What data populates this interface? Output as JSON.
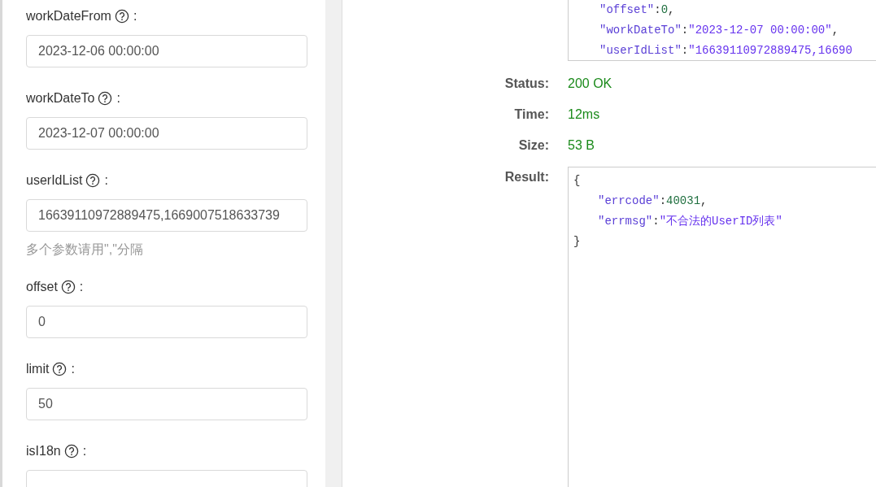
{
  "params": [
    {
      "label": "workDateFrom",
      "colon": ":",
      "value": "2023-12-06 00:00:00"
    },
    {
      "label": "workDateTo",
      "colon": ":",
      "value": "2023-12-07 00:00:00"
    },
    {
      "label": "userIdList",
      "colon": ":",
      "value": "16639110972889475,1669007518633739",
      "hint": "多个参数请用\",\"分隔"
    },
    {
      "label": "offset",
      "colon": ":",
      "value": "0"
    },
    {
      "label": "limit",
      "colon": ":",
      "value": "50"
    },
    {
      "label": "isI18n",
      "colon": ":"
    }
  ],
  "request_body": [
    {
      "kind": "number",
      "key": "\"offset\"",
      "colon": ":",
      "value": "0",
      "comma": ","
    },
    {
      "kind": "string",
      "key": "\"workDateTo\"",
      "colon": ":",
      "value": "\"2023-12-07 00:00:00\"",
      "comma": ","
    },
    {
      "kind": "string",
      "key": "\"userIdList\"",
      "colon": ":",
      "value": "\"16639110972889475,16690"
    }
  ],
  "response_meta": [
    {
      "label": "Status:",
      "value": "200 OK"
    },
    {
      "label": "Time:",
      "value": "12ms"
    },
    {
      "label": "Size:",
      "value": "53 B"
    }
  ],
  "result": {
    "label": "Result:",
    "lines": [
      {
        "kind": "brace",
        "text": "{"
      },
      {
        "kind": "number",
        "key": "\"errcode\"",
        "colon": ":",
        "value": "40031",
        "comma": ","
      },
      {
        "kind": "string",
        "key": "\"errmsg\"",
        "colon": ":",
        "value": "\"不合法的UserID列表\""
      },
      {
        "kind": "brace",
        "text": "}"
      }
    ]
  }
}
